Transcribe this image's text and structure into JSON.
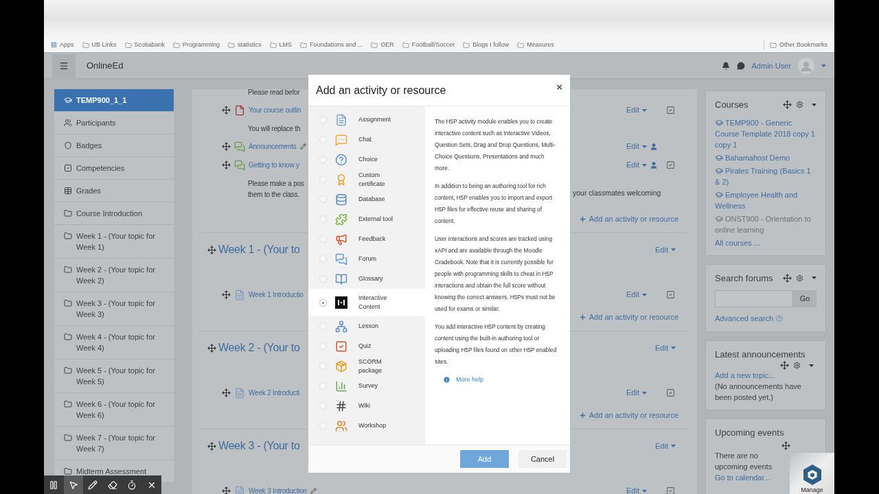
{
  "bookmarks": [
    {
      "label": "Apps",
      "kind": "apps"
    },
    {
      "label": "UB Links",
      "kind": "folder"
    },
    {
      "label": "Scotiabank",
      "kind": "folder"
    },
    {
      "label": "Programming",
      "kind": "folder"
    },
    {
      "label": "statistics",
      "kind": "folder"
    },
    {
      "label": "LMS",
      "kind": "folder"
    },
    {
      "label": "Foundations and ...",
      "kind": "folder"
    },
    {
      "label": "OER",
      "kind": "folder"
    },
    {
      "label": "Football/Soccer",
      "kind": "folder"
    },
    {
      "label": "Blogs I follow",
      "kind": "folder"
    },
    {
      "label": "Measures",
      "kind": "folder"
    }
  ],
  "other_bookmarks": "Other Bookmarks",
  "navbar": {
    "site_name": "OnlineEd",
    "user_name": "Admin User"
  },
  "course_nav": [
    {
      "label": "TEMP900_1_1",
      "kind": "course",
      "selected": true
    },
    {
      "label": "Participants",
      "kind": "participants",
      "selected": false
    },
    {
      "label": "Badges",
      "kind": "badges",
      "selected": false
    },
    {
      "label": "Competencies",
      "kind": "competencies",
      "selected": false
    },
    {
      "label": "Grades",
      "kind": "grades",
      "selected": false
    },
    {
      "label": "Course Introduction",
      "kind": "section",
      "selected": false
    },
    {
      "label": "Week 1 - (Your topic for Week 1)",
      "kind": "section",
      "selected": false
    },
    {
      "label": "Week 2 - (Your topic for Week 2)",
      "kind": "section",
      "selected": false
    },
    {
      "label": "Week 3 - (Your topic for Week 3)",
      "kind": "section",
      "selected": false
    },
    {
      "label": "Week 4 - (Your topic for Week 4)",
      "kind": "section",
      "selected": false
    },
    {
      "label": "Week 5 - (Your topic for Week 5)",
      "kind": "section",
      "selected": false
    },
    {
      "label": "Week 6 - (Your topic for Week 6)",
      "kind": "section",
      "selected": false
    },
    {
      "label": "Week 7 - (Your topic for Week 7)",
      "kind": "section",
      "selected": false
    },
    {
      "label": "Midterm Assessment",
      "kind": "section",
      "selected": false
    }
  ],
  "course_content": [
    {
      "kind": "note",
      "text": "Please read befor"
    },
    {
      "kind": "pdf",
      "text": "Your course outlin",
      "edit": "Edit",
      "person": false,
      "checkbox": true,
      "pencil": false
    },
    {
      "kind": "note",
      "text": "You will replace th"
    },
    {
      "kind": "forum",
      "text": "Announcements",
      "edit": "Edit",
      "person": true,
      "checkbox": false,
      "pencil": true
    },
    {
      "kind": "forum",
      "text": "Getting to know y",
      "edit": "Edit",
      "person": true,
      "checkbox": true,
      "pencil": false
    },
    {
      "kind": "paragraph",
      "lines": [
        "Please make a pos",
        "them to the class."
      ],
      "right": "your classmates welcoming"
    },
    {
      "kind": "add",
      "text": "Add an activity or resource"
    },
    {
      "kind": "section",
      "text": "Week 1 - (Your to",
      "edit": "Edit"
    },
    {
      "kind": "page",
      "text": "Week 1 Introductio",
      "edit": "Edit",
      "person": false,
      "checkbox": true,
      "pencil": false
    },
    {
      "kind": "add",
      "text": "Add an activity or resource"
    },
    {
      "kind": "section",
      "text": "Week 2 - (Your to",
      "edit": "Edit"
    },
    {
      "kind": "page",
      "text": "Week 2 Introducti",
      "edit": "Edit",
      "person": false,
      "checkbox": true,
      "pencil": false
    },
    {
      "kind": "add",
      "text": "Add an activity or resource"
    },
    {
      "kind": "section",
      "text": "Week 3 - (Your to",
      "edit": "Edit"
    },
    {
      "kind": "page",
      "text": "Week 3 Introduction",
      "edit": "Edit",
      "person": false,
      "checkbox": true,
      "pencil": true
    }
  ],
  "courses_block": {
    "title": "Courses",
    "items": [
      {
        "label": "TEMP900 - Generic Course Template 2018 copy 1 copy 1",
        "hidden": false
      },
      {
        "label": "Bahamahost Demo",
        "hidden": false
      },
      {
        "label": "Pirates Training (Basics 1 & 2)",
        "hidden": false
      },
      {
        "label": "Employee Health and Wellness",
        "hidden": false
      },
      {
        "label": "ONST900 - Orientation to online learning",
        "hidden": true
      }
    ],
    "all_link": "All courses ..."
  },
  "search_block": {
    "title": "Search forums",
    "button": "Go",
    "advanced": "Advanced search"
  },
  "announcements_block": {
    "title": "Latest announcements",
    "add_link": "Add a new topic...",
    "empty": "(No announcements have been posted yet.)"
  },
  "events_block": {
    "title": "Upcoming events",
    "empty": "There are no upcoming events",
    "link": "Go to calendar..."
  },
  "manage_badge": "Manage",
  "dialog": {
    "title": "Add an activity or resource",
    "close": "×",
    "options": [
      {
        "label": "Assignment",
        "selected": false
      },
      {
        "label": "Chat",
        "selected": false
      },
      {
        "label": "Choice",
        "selected": false
      },
      {
        "label": "Custom certificate",
        "selected": false
      },
      {
        "label": "Database",
        "selected": false
      },
      {
        "label": "External tool",
        "selected": false
      },
      {
        "label": "Feedback",
        "selected": false
      },
      {
        "label": "Forum",
        "selected": false
      },
      {
        "label": "Glossary",
        "selected": false
      },
      {
        "label": "Interactive Content",
        "selected": true
      },
      {
        "label": "Lesson",
        "selected": false
      },
      {
        "label": "Quiz",
        "selected": false
      },
      {
        "label": "SCORM package",
        "selected": false
      },
      {
        "label": "Survey",
        "selected": false
      },
      {
        "label": "Wiki",
        "selected": false
      },
      {
        "label": "Workshop",
        "selected": false
      }
    ],
    "description": [
      "The H5P activity module enables you to create interactive content such as Interactive Videos, Question Sets, Drag and Drop Questions, Multi-Choice Questions, Presentations and much more.",
      "In addition to being an authoring tool for rich content, H5P enables you to import and export H5P files for effective reuse and sharing of content.",
      "User interactions and scores are tracked using xAPI and are available through the Moodle Gradebook. Note that it is currently possible for people with programming skills to cheat in H5P interactions and obtain the full score without knowing the correct answers. H5Ps must not be used for exams or similar.",
      "You add interactive H5P content by creating content using the built-in authoring tool or uploading H5P files found on other H5P enabled sites."
    ],
    "more_help": "More help",
    "add_button": "Add",
    "cancel_button": "Cancel"
  },
  "recorder_toolbar": [
    {
      "kind": "pause",
      "selected": false
    },
    {
      "kind": "pointer",
      "selected": true
    },
    {
      "kind": "pen",
      "selected": false
    },
    {
      "kind": "eraser",
      "selected": false
    },
    {
      "kind": "timer",
      "selected": false
    },
    {
      "kind": "close",
      "selected": false
    }
  ]
}
